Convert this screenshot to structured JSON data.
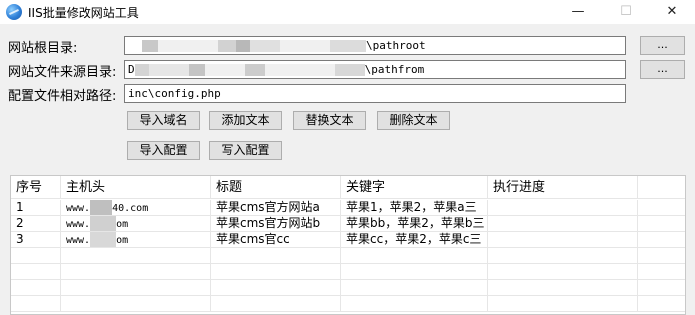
{
  "window": {
    "title": "IIS批量修改网站工具",
    "minimize": "—",
    "maximize": "☐",
    "close": "✕"
  },
  "form": {
    "root_label": "网站根目录:",
    "root_value_suffix": "\\pathroot",
    "source_label": "网站文件来源目录:",
    "source_value_prefix": "D",
    "source_value_suffix": "\\pathfrom",
    "config_label": "配置文件相对路径:",
    "config_value": "inc\\config.php",
    "browse_label": "..."
  },
  "buttons": {
    "import_domain": "导入域名",
    "add_text": "添加文本",
    "replace_text": "替换文本",
    "delete_text": "删除文本",
    "import_config": "导入配置",
    "write_config": "写入配置"
  },
  "table": {
    "columns": [
      "序号",
      "主机头",
      "标题",
      "关键字",
      "执行进度"
    ],
    "rows": [
      {
        "id": "1",
        "host_prefix": "www.",
        "host_suffix": "40.com",
        "title": "苹果cms官方网站a",
        "keywords": "苹果1，苹果2，苹果a三"
      },
      {
        "id": "2",
        "host_prefix": "www.",
        "host_suffix": "om",
        "title": "苹果cms官方网站b",
        "keywords": "苹果bb，苹果2，苹果b三"
      },
      {
        "id": "3",
        "host_prefix": "www.",
        "host_suffix": "om",
        "title": "苹果cms官cc",
        "keywords": "苹果cc，苹果2，苹果c三"
      }
    ]
  },
  "colors": {
    "titlebar_bg": "#ffffff",
    "window_bg": "#f0f0f0",
    "redaction_gray": "#c8c8c8"
  }
}
